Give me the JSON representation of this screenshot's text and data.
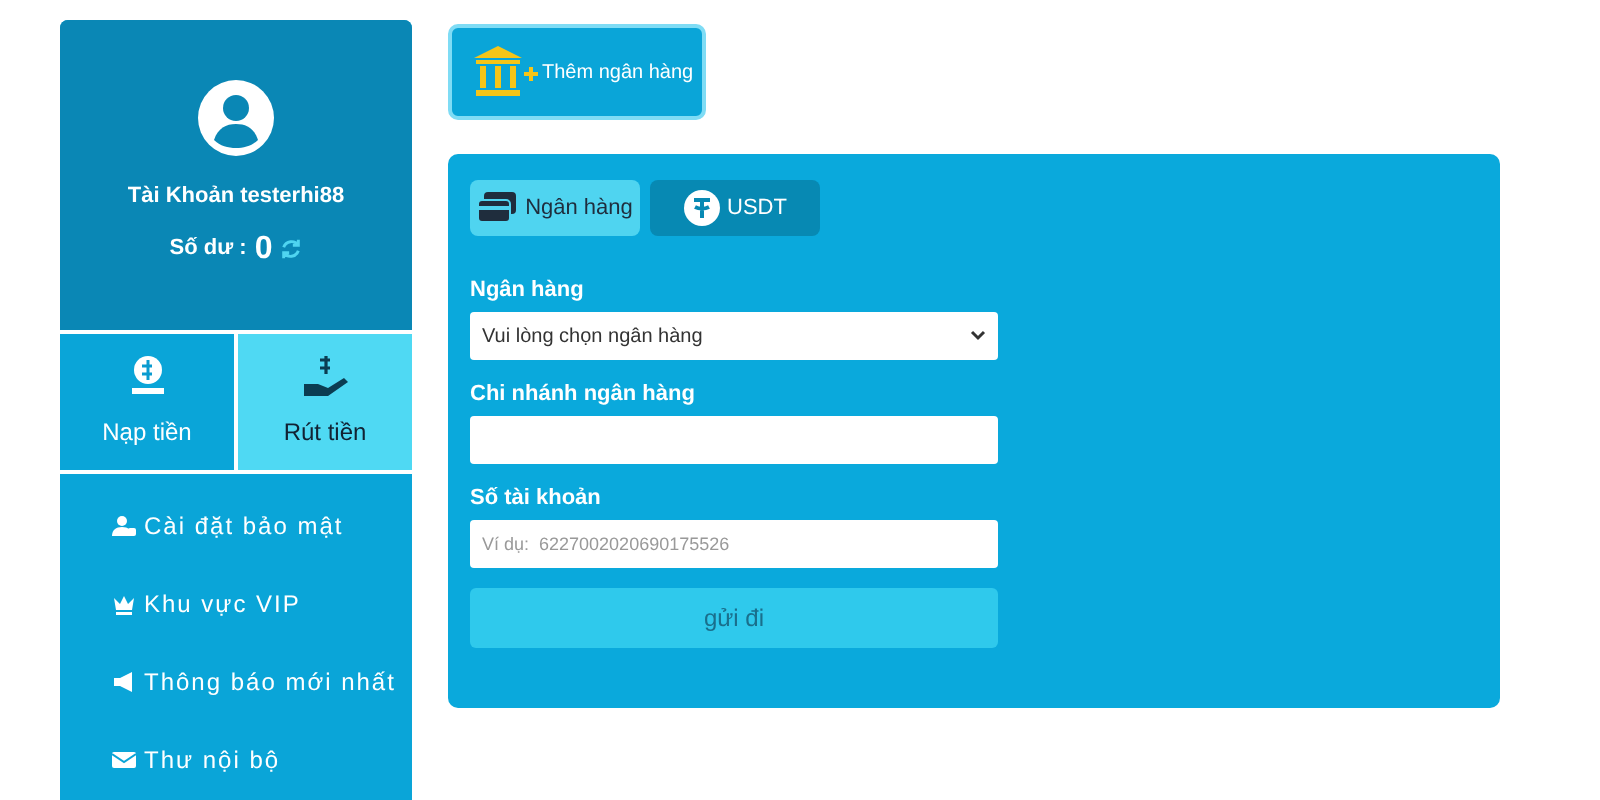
{
  "profile": {
    "account_label": "Tài Khoản testerhi88",
    "balance_label": "Số dư :",
    "balance": "0"
  },
  "actions": [
    {
      "label": "Nạp tiền",
      "kind": "deposit",
      "selected": false
    },
    {
      "label": "Rút tiền",
      "kind": "withdraw",
      "selected": true
    }
  ],
  "menu": [
    {
      "label": "Cài đặt bảo mật",
      "kind": "security"
    },
    {
      "label": "Khu vực VIP",
      "kind": "vip"
    },
    {
      "label": "Thông báo mới nhất",
      "kind": "news"
    },
    {
      "label": "Thư nội bộ",
      "kind": "mail"
    }
  ],
  "add_bank_button": "Thêm ngân hàng",
  "tabs": [
    {
      "label": "Ngân hàng",
      "kind": "bank",
      "selected": true
    },
    {
      "label": "USDT",
      "kind": "usdt",
      "selected": false
    }
  ],
  "form": {
    "fields": [
      {
        "label": "Ngân hàng",
        "kind": "select",
        "value": "Vui lòng chọn ngân hàng"
      },
      {
        "label": "Chi nhánh ngân hàng",
        "kind": "text"
      },
      {
        "label": "Số tài khoản",
        "kind": "text",
        "placeholder": "Ví dụ:  6227002020690175526"
      }
    ],
    "submit": "gửi đi"
  }
}
